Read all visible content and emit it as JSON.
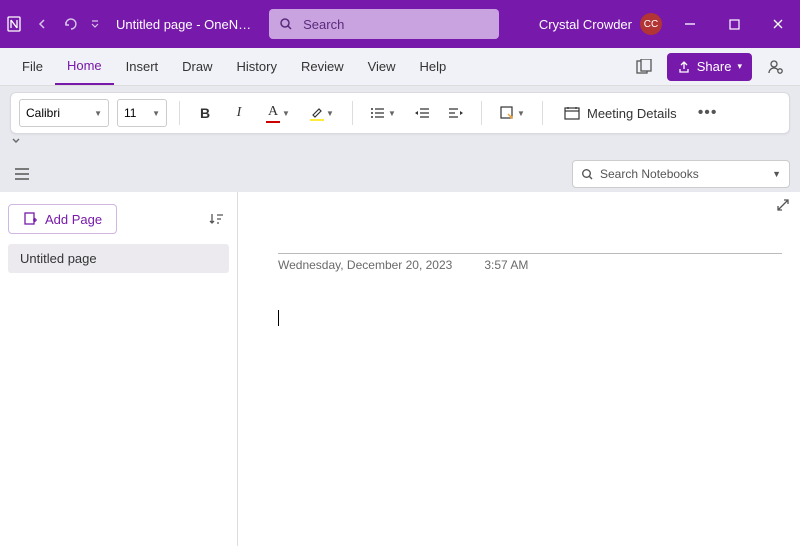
{
  "titlebar": {
    "doc_title": "Untitled page  -  OneN…",
    "search_placeholder": "Search",
    "user_name": "Crystal Crowder",
    "user_initials": "CC"
  },
  "menu": {
    "tabs": [
      "File",
      "Home",
      "Insert",
      "Draw",
      "History",
      "Review",
      "View",
      "Help"
    ],
    "active_tab": "Home",
    "share_label": "Share"
  },
  "ribbon": {
    "font_name": "Calibri",
    "font_size": "11",
    "meeting_label": "Meeting Details"
  },
  "secbar": {
    "notebook_search_placeholder": "Search Notebooks"
  },
  "sidebar": {
    "add_page_label": "Add Page",
    "pages": [
      {
        "title": "Untitled page"
      }
    ]
  },
  "editor": {
    "date": "Wednesday, December 20, 2023",
    "time": "3:57 AM"
  }
}
